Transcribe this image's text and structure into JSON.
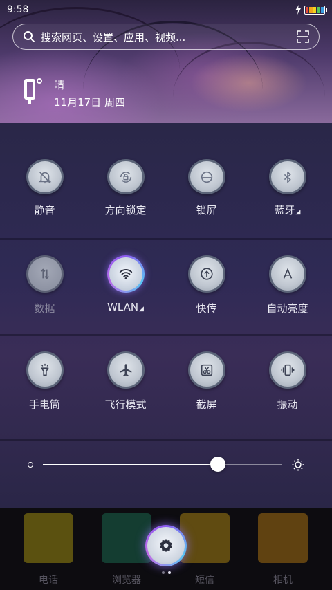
{
  "status_bar": {
    "time": "9:58"
  },
  "search": {
    "placeholder": "搜索网页、设置、应用、视频..."
  },
  "weather": {
    "condition": "晴",
    "date": "11月17日 周四"
  },
  "toggles": [
    {
      "label": "静音",
      "icon": "bell-off-icon"
    },
    {
      "label": "方向锁定",
      "icon": "rotation-lock-icon"
    },
    {
      "label": "锁屏",
      "icon": "lock-icon"
    },
    {
      "label": "蓝牙",
      "icon": "bluetooth-icon"
    },
    {
      "label": "数据",
      "icon": "mobile-data-icon"
    },
    {
      "label": "WLAN",
      "icon": "wifi-icon"
    },
    {
      "label": "快传",
      "icon": "quick-transfer-icon"
    },
    {
      "label": "自动亮度",
      "icon": "auto-brightness-icon"
    },
    {
      "label": "手电筒",
      "icon": "flashlight-icon"
    },
    {
      "label": "飞行模式",
      "icon": "airplane-icon"
    },
    {
      "label": "截屏",
      "icon": "screenshot-icon"
    },
    {
      "label": "振动",
      "icon": "vibrate-icon"
    }
  ],
  "brightness": {
    "level": 0.73
  },
  "dock": [
    {
      "label": "电话",
      "icon": "phone-icon",
      "color": "#d9c313"
    },
    {
      "label": "浏览器",
      "icon": "browser-icon",
      "color": "#1f8d6a"
    },
    {
      "label": "短信",
      "icon": "messages-icon",
      "color": "#e7b214"
    },
    {
      "label": "相机",
      "icon": "camera-icon",
      "color": "#e79a14"
    }
  ],
  "colors": {
    "accent": "#8c5cf0",
    "accent_secondary": "#59c5f5"
  }
}
